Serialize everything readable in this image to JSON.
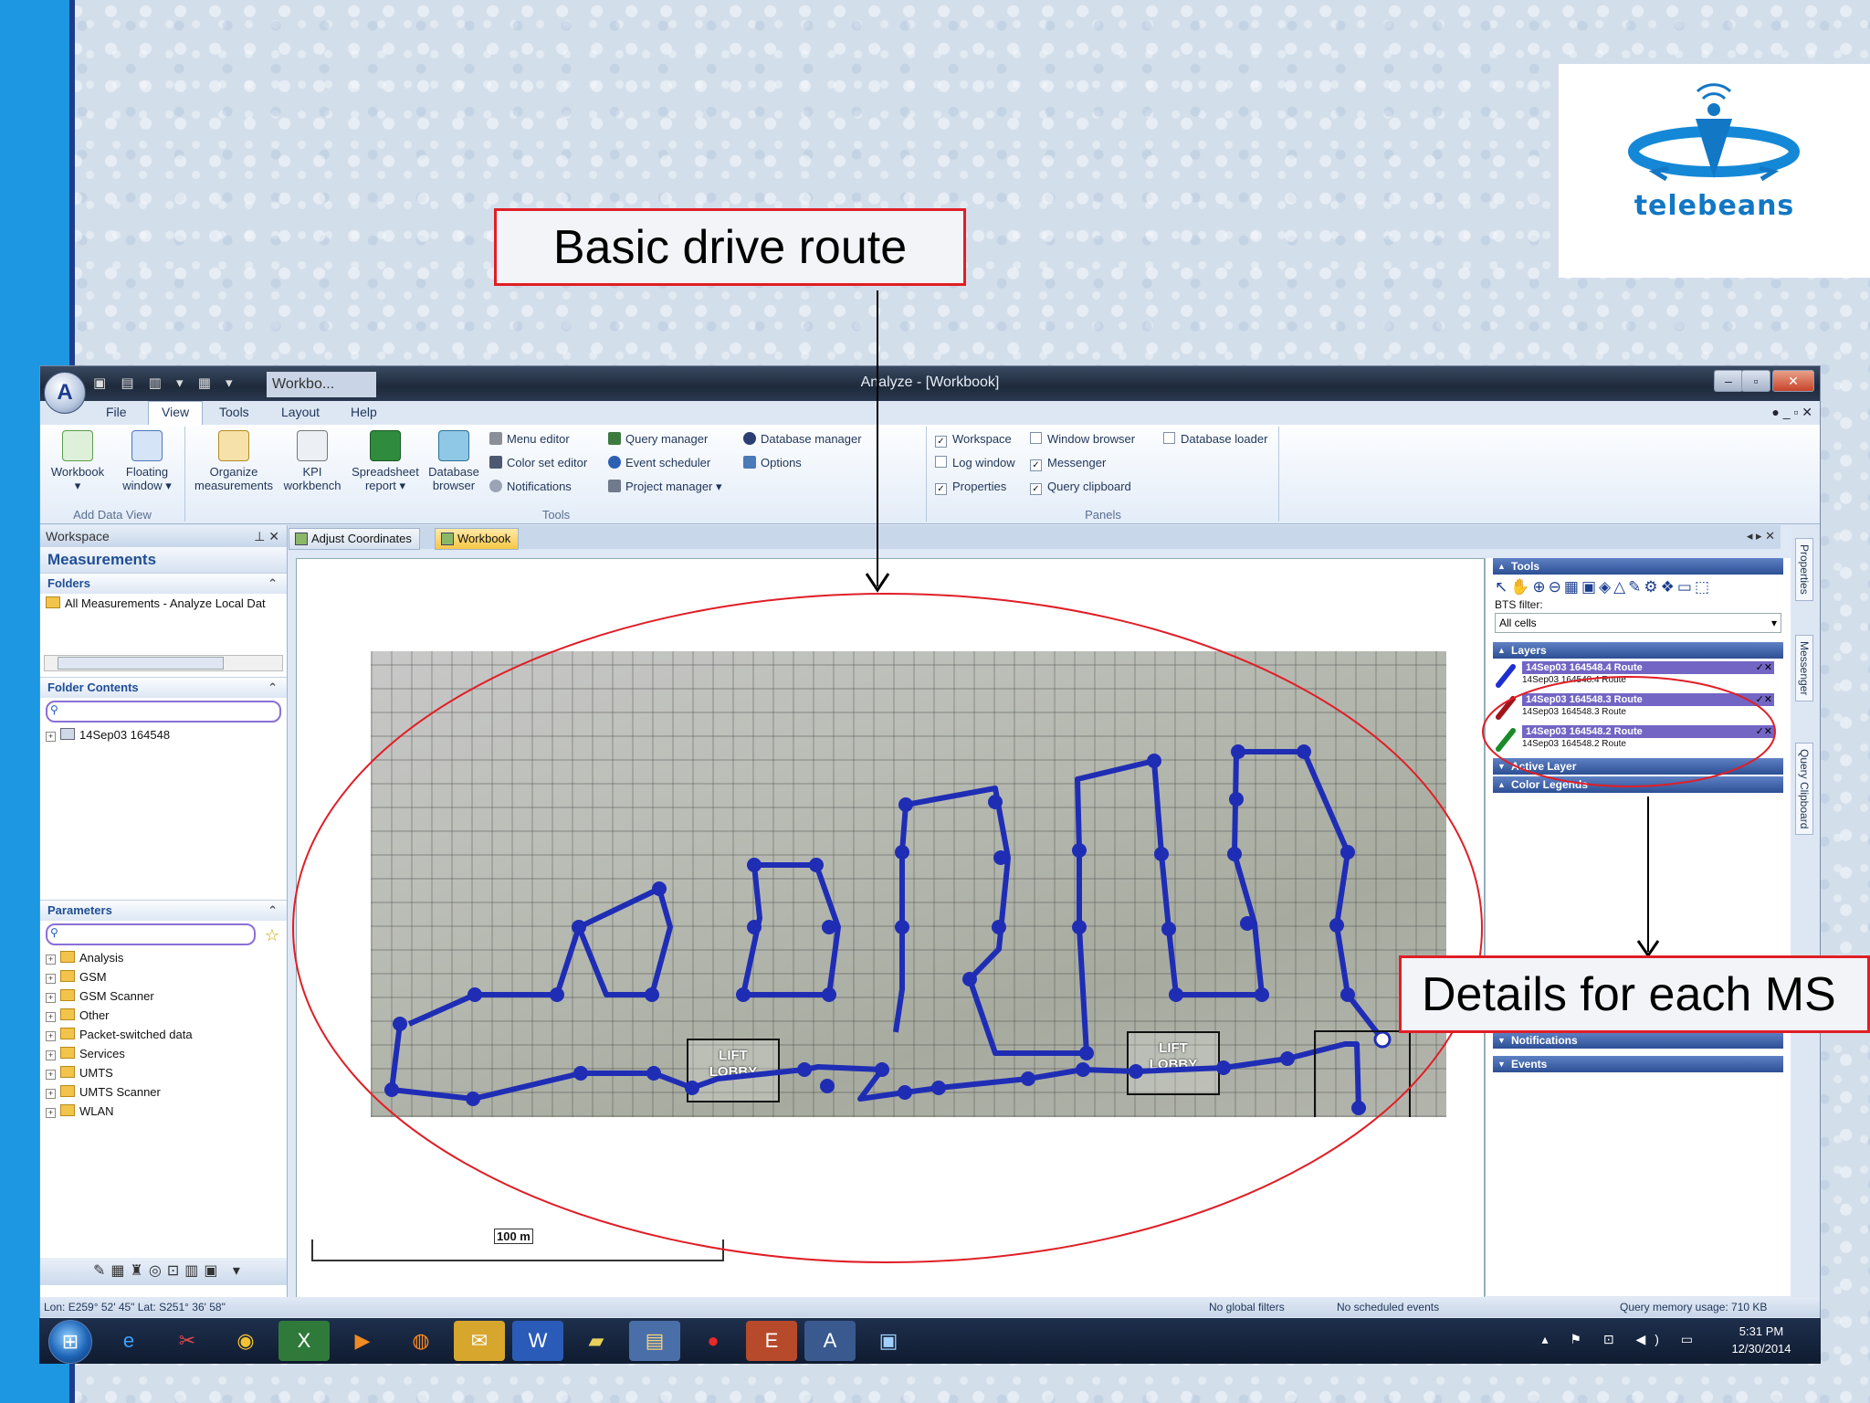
{
  "callouts": {
    "top": "Basic drive route",
    "right": "Details for each MS"
  },
  "brand": {
    "logo_text": "telebeans",
    "accent": "#1277c4"
  },
  "window": {
    "tab": "Workbo...",
    "title": "Analyze - [Workbook]",
    "minimize": "–",
    "restore": "▫",
    "close": "✕"
  },
  "menu": {
    "items": [
      "File",
      "View",
      "Tools",
      "Layout",
      "Help"
    ],
    "active": "View",
    "help_controls": "● _ ▫ ✕"
  },
  "ribbon": {
    "add_data_view": {
      "label": "Add Data View",
      "buttons": [
        {
          "label": "Workbook",
          "sub": "▾",
          "icon": "workbook-icon"
        },
        {
          "label": "Floating",
          "sub": "window ▾",
          "icon": "floating-window-icon"
        }
      ]
    },
    "tools": {
      "label": "Tools",
      "big": [
        {
          "label": "Organize",
          "sub": "measurements",
          "icon": "organize-icon"
        },
        {
          "label": "KPI",
          "sub": "workbench",
          "icon": "kpi-icon"
        },
        {
          "label": "Spreadsheet",
          "sub": "report ▾",
          "icon": "spreadsheet-icon"
        },
        {
          "label": "Database",
          "sub": "browser",
          "icon": "database-icon"
        }
      ],
      "small": [
        "Menu editor",
        "Color set editor",
        "Notifications",
        "Query manager",
        "Event scheduler",
        "Project manager ▾",
        "Database manager",
        "Options"
      ]
    },
    "panels": {
      "label": "Panels",
      "checks": [
        {
          "label": "Workspace",
          "checked": true
        },
        {
          "label": "Log window",
          "checked": false
        },
        {
          "label": "Properties",
          "checked": true
        },
        {
          "label": "Window browser",
          "checked": false
        },
        {
          "label": "Messenger",
          "checked": true
        },
        {
          "label": "Query clipboard",
          "checked": true
        },
        {
          "label": "Database loader",
          "checked": false
        }
      ]
    }
  },
  "workspace": {
    "header": "Workspace",
    "header_controls": "⊥ ✕",
    "section": "Measurements",
    "folders_label": "Folders",
    "folder_item": "All Measurements - Analyze Local Dat",
    "folder_contents_label": "Folder Contents",
    "content_item": "14Sep03 164548",
    "parameters_label": "Parameters",
    "parameters": [
      "Analysis",
      "GSM",
      "GSM Scanner",
      "Other",
      "Packet-switched data",
      "Services",
      "UMTS",
      "UMTS Scanner",
      "WLAN"
    ]
  },
  "doc_tabs": [
    "Adjust Coordinates",
    "Workbook"
  ],
  "doc_tabs_active": "Workbook",
  "doc_nav": "◂ ▸ ✕",
  "map": {
    "lift_labels": [
      "LIFT\nLOBBY",
      "LIFT\nLOBBY"
    ],
    "scale_label": "100 m",
    "route_color": "#1f2db5"
  },
  "tool_pane": {
    "tools_label": "Tools",
    "tool_icons": "↖✋⊕⊖▦▣◈△✎⚙❖▭⬚",
    "bts_filter_label": "BTS filter:",
    "bts_filter_value": "All cells",
    "layers_label": "Layers",
    "layers": [
      {
        "title": "14Sep03 164548.4 Route",
        "sub": "14Sep03 164548.4 Route",
        "color": "#1d2fd0"
      },
      {
        "title": "14Sep03 164548.3 Route",
        "sub": "14Sep03 164548.3 Route",
        "color": "#a0151b"
      },
      {
        "title": "14Sep03 164548.2 Route",
        "sub": "14Sep03 164548.2 Route",
        "color": "#1a8b2a"
      }
    ],
    "layer_check": "✓✕",
    "active_layer_label": "Active Layer",
    "color_legends_label": "Color Legends",
    "notifications_label": "Notifications",
    "events_label": "Events"
  },
  "side_tabs": [
    "Properties",
    "Messenger",
    "Query Clipboard"
  ],
  "status": {
    "coords": "Lon: E259° 52' 45\" Lat: S251° 36' 58\"",
    "filters": "No global filters",
    "events": "No scheduled events",
    "memory": "Query memory usage: 710 KB"
  },
  "taskbar": {
    "apps": [
      "internet-explorer-icon",
      "snipping-tool-icon",
      "chrome-icon",
      "excel-icon",
      "media-player-icon",
      "firefox-icon",
      "outlook-icon",
      "word-icon",
      "notes-icon",
      "explorer-icon",
      "vodafone-icon",
      "access-icon",
      "analyze-icon",
      "picture-icon"
    ],
    "tray": "▴ ⚑ ⊡ ◀) ▭",
    "time": "5:31 PM",
    "date": "12/30/2014"
  }
}
